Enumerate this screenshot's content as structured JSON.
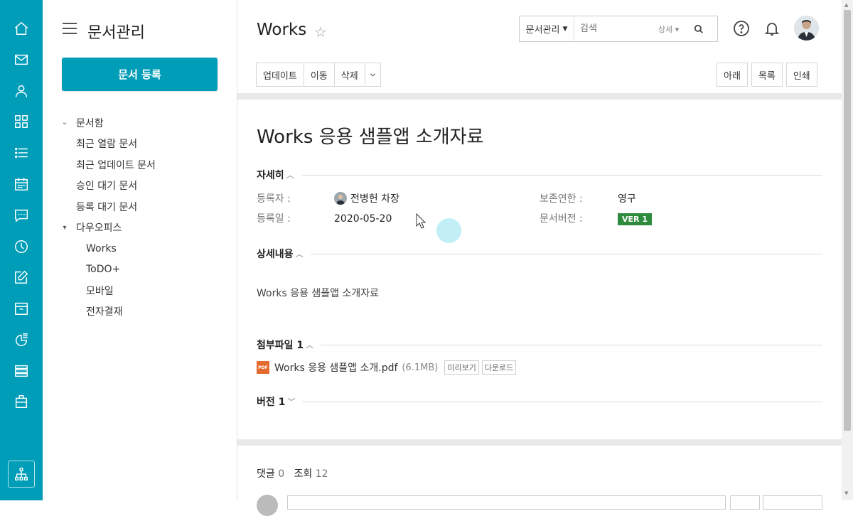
{
  "sidebar": {
    "title": "문서관리",
    "register_button": "문서 등록",
    "tree": [
      {
        "label": "문서함",
        "level": 0,
        "chevron": "⌄"
      },
      {
        "label": "최근 열람 문서",
        "level": 1
      },
      {
        "label": "최근 업데이트 문서",
        "level": 1
      },
      {
        "label": "승인 대기 문서",
        "level": 1
      },
      {
        "label": "등록 대기 문서",
        "level": 1
      },
      {
        "label": "다우오피스",
        "level": 0,
        "chevron": "▾"
      },
      {
        "label": "Works",
        "level": 2
      },
      {
        "label": "ToDO+",
        "level": 2
      },
      {
        "label": "모바일",
        "level": 2
      },
      {
        "label": "전자결재",
        "level": 2
      }
    ]
  },
  "header": {
    "title": "Works",
    "search": {
      "scope": "문서관리",
      "placeholder": "검색",
      "detail": "상세"
    }
  },
  "toolbar": {
    "left": [
      "업데이트",
      "이동",
      "삭제"
    ],
    "right": [
      "아래",
      "목록",
      "인쇄"
    ]
  },
  "doc": {
    "title": "Works 응용 샘플앱 소개자료",
    "detail_section": "자세히",
    "registrant_label": "등록자 :",
    "registrant": "전병헌 차장",
    "date_label": "등록일 :",
    "date": "2020-05-20",
    "retention_label": "보존연한 :",
    "retention": "영구",
    "version_label": "문서버전 :",
    "version_badge": "VER 1",
    "content_section": "상세내용",
    "content": "Works 응용 샘플앱 소개자료",
    "attach_section": "첨부파일 1",
    "file_name": "Works 응용 샘플앱 소개.pdf",
    "file_size": "(6.1MB)",
    "preview": "미리보기",
    "download": "다운로드",
    "version_section": "버전 1"
  },
  "stats": {
    "comments_label": "댓글",
    "comments": "0",
    "views_label": "조회",
    "views": "12"
  },
  "colors": {
    "accent": "#009db8",
    "version_badge": "#2e8b3e"
  }
}
